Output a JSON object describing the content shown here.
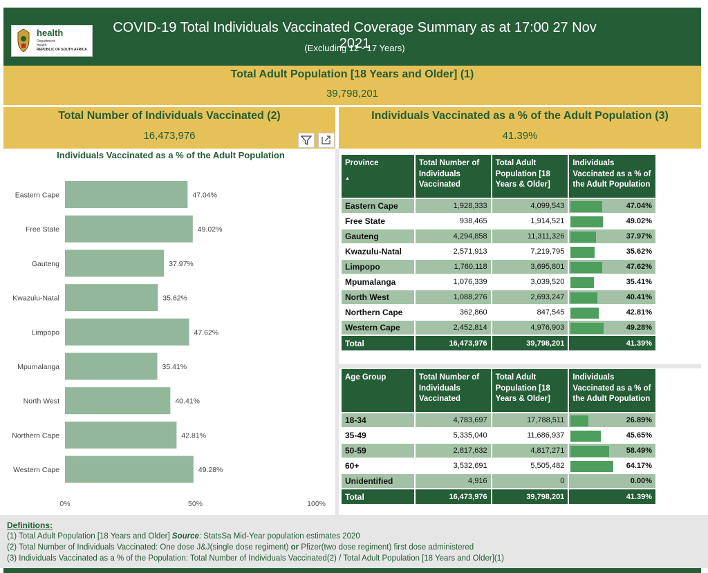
{
  "header": {
    "title": "COVID-19 Total Individuals Vaccinated Coverage Summary as at 17:00 27 Nov 2021",
    "subtitle": "(Excluding 12 - 17 Years)",
    "logo": {
      "name": "health",
      "line1": "Department:",
      "line2": "Health",
      "line3": "REPUBLIC OF SOUTH AFRICA"
    }
  },
  "kpis": {
    "adult_population": {
      "title": "Total Adult Population [18 Years and Older] (1)",
      "value": "39,798,201"
    },
    "total_vaccinated": {
      "title": "Total Number of Individuals Vaccinated (2)",
      "value": "16,473,976"
    },
    "pct_vaccinated": {
      "title": "Individuals Vaccinated as a % of the Adult Population (3)",
      "value": "41.39%"
    }
  },
  "toolbar": {
    "filter_icon": "filter-icon",
    "focus_icon": "focus-mode-icon"
  },
  "chart_data": {
    "type": "bar",
    "orientation": "horizontal",
    "title": "Individuals Vaccinated as a % of the Adult Population",
    "categories": [
      "Eastern Cape",
      "Free State",
      "Gauteng",
      "Kwazulu-Natal",
      "Limpopo",
      "Mpumalanga",
      "North West",
      "Northern Cape",
      "Western Cape"
    ],
    "values": [
      47.04,
      49.02,
      37.97,
      35.62,
      47.62,
      35.41,
      40.41,
      42.81,
      49.28
    ],
    "value_labels": [
      "47.04%",
      "49.02%",
      "37.97%",
      "35.62%",
      "47.62%",
      "35.41%",
      "40.41%",
      "42.81%",
      "49.28%"
    ],
    "xlim": [
      0,
      100
    ],
    "x_ticks": [
      "0%",
      "50%",
      "100%"
    ],
    "grid": false,
    "bar_color": "#93b79a"
  },
  "province_table": {
    "headers": [
      "Province",
      "Total Number of Individuals Vaccinated",
      "Total Adult Population [18 Years & Older]",
      "Individuals Vaccinated as a % of the Adult Population"
    ],
    "rows": [
      {
        "name": "Eastern Cape",
        "vaccinated": "1,928,333",
        "population": "4,099,543",
        "pct_label": "47.04%",
        "pct": 47.04
      },
      {
        "name": "Free State",
        "vaccinated": "938,465",
        "population": "1,914,521",
        "pct_label": "49.02%",
        "pct": 49.02
      },
      {
        "name": "Gauteng",
        "vaccinated": "4,294,858",
        "population": "11,311,326",
        "pct_label": "37.97%",
        "pct": 37.97
      },
      {
        "name": "Kwazulu-Natal",
        "vaccinated": "2,571,913",
        "population": "7,219,795",
        "pct_label": "35.62%",
        "pct": 35.62
      },
      {
        "name": "Limpopo",
        "vaccinated": "1,760,118",
        "population": "3,695,801",
        "pct_label": "47.62%",
        "pct": 47.62
      },
      {
        "name": "Mpumalanga",
        "vaccinated": "1,076,339",
        "population": "3,039,520",
        "pct_label": "35.41%",
        "pct": 35.41
      },
      {
        "name": "North West",
        "vaccinated": "1,088,276",
        "population": "2,693,247",
        "pct_label": "40.41%",
        "pct": 40.41
      },
      {
        "name": "Northern Cape",
        "vaccinated": "362,860",
        "population": "847,545",
        "pct_label": "42.81%",
        "pct": 42.81
      },
      {
        "name": "Western Cape",
        "vaccinated": "2,452,814",
        "population": "4,976,903",
        "pct_label": "49.28%",
        "pct": 49.28
      }
    ],
    "total": {
      "name": "Total",
      "vaccinated": "16,473,976",
      "population": "39,798,201",
      "pct_label": "41.39%"
    }
  },
  "age_table": {
    "headers": [
      "Age Group",
      "Total Number of Individuals Vaccinated",
      "Total Adult Population [18 Years & Older]",
      "Individuals Vaccinated as a % of the Adult Population"
    ],
    "rows": [
      {
        "name": "18-34",
        "vaccinated": "4,783,697",
        "population": "17,788,511",
        "pct_label": "26.89%",
        "pct": 26.89
      },
      {
        "name": "35-49",
        "vaccinated": "5,335,040",
        "population": "11,686,937",
        "pct_label": "45.65%",
        "pct": 45.65
      },
      {
        "name": "50-59",
        "vaccinated": "2,817,632",
        "population": "4,817,271",
        "pct_label": "58.49%",
        "pct": 58.49
      },
      {
        "name": "60+",
        "vaccinated": "3,532,691",
        "population": "5,505,482",
        "pct_label": "64.17%",
        "pct": 64.17
      },
      {
        "name": "Unidentified",
        "vaccinated": "4,916",
        "population": "0",
        "pct_label": "0.00%",
        "pct": 0
      }
    ],
    "total": {
      "name": "Total",
      "vaccinated": "16,473,976",
      "population": "39,798,201",
      "pct_label": "41.39%"
    }
  },
  "definitions": {
    "heading": "Definitions:",
    "d1_pre": "(1) Total Adult Population [18 Years and Older] ",
    "d1_bold": "Source",
    "d1_post": ": StatsSa Mid-Year population estimates 2020",
    "d2_pre": "(2) Total Number of Individuals Vaccinated: One dose J&J(single dose regiment) ",
    "d2_bold": "or",
    "d2_post": " Pfizer(two dose regiment) first dose administered",
    "d3": "(3) Individuals Vaccinated as a % of the Population: Total Number of Individuals Vaccinated(2) / Total Adult Population [18 Years and Older](1)"
  },
  "colors": {
    "brand_green": "#245d36",
    "gold": "#e5c158",
    "bar_green": "#4e9e5e",
    "light_green": "#a3c2a5"
  }
}
